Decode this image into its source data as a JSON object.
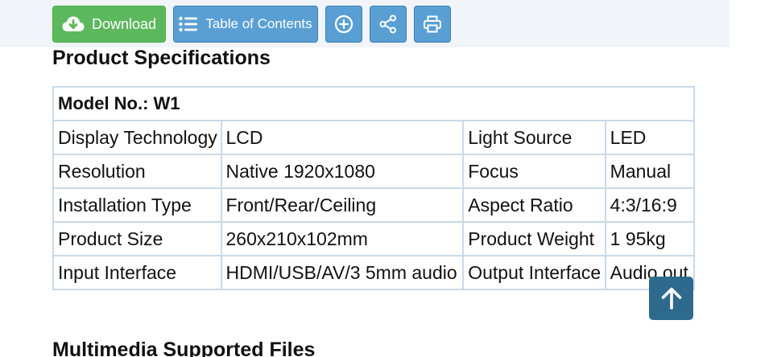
{
  "toolbar": {
    "download_label": "Download",
    "toc_label": "Table of Contents",
    "icons": [
      "cloud-download-icon",
      "list-icon",
      "plus-circle-icon",
      "share-icon",
      "print-icon"
    ]
  },
  "specs": {
    "title": "Product Specifications",
    "model": "Model No.: W1",
    "rows": [
      [
        "Display Technology",
        "LCD",
        "Light Source",
        "LED"
      ],
      [
        "Resolution",
        "Native 1920x1080",
        "Focus",
        "Manual"
      ],
      [
        "Installation Type",
        "Front/Rear/Ceiling",
        "Aspect Ratio",
        "4:3/16:9"
      ],
      [
        "Product Size",
        "260x210x102mm",
        "Product Weight",
        "1 95kg"
      ],
      [
        "Input Interface",
        "HDMI/USB/AV/3 5mm audio",
        "Output Interface",
        "Audio out"
      ]
    ]
  },
  "multimedia": {
    "title": "Multimedia Supported Files"
  },
  "colors": {
    "download_button": "#5cb85c",
    "toolbar_button": "#5a9fd4",
    "back_to_top_button": "#2e6a8e",
    "table_border": "#c9d9e8"
  }
}
